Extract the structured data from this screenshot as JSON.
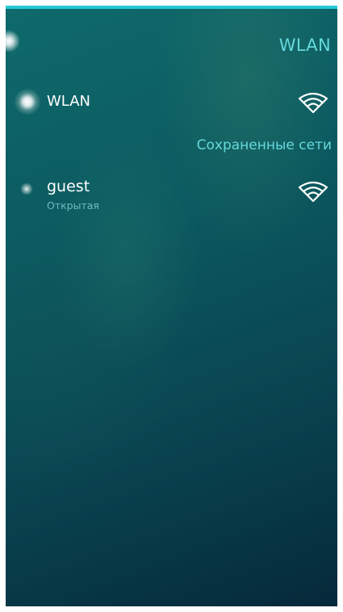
{
  "header": {
    "title": "WLAN"
  },
  "wlan_toggle": {
    "label": "WLAN",
    "enabled": true,
    "icon": "wifi-icon"
  },
  "saved_section": {
    "title": "Сохраненные сети"
  },
  "networks": [
    {
      "name": "guest",
      "security": "Открытая",
      "icon": "wifi-icon"
    }
  ],
  "colors": {
    "accent": "#26c9d3",
    "highlight_text": "#66d8dc",
    "primary_text": "#ffffff",
    "secondary_text": "#6fb9be"
  }
}
